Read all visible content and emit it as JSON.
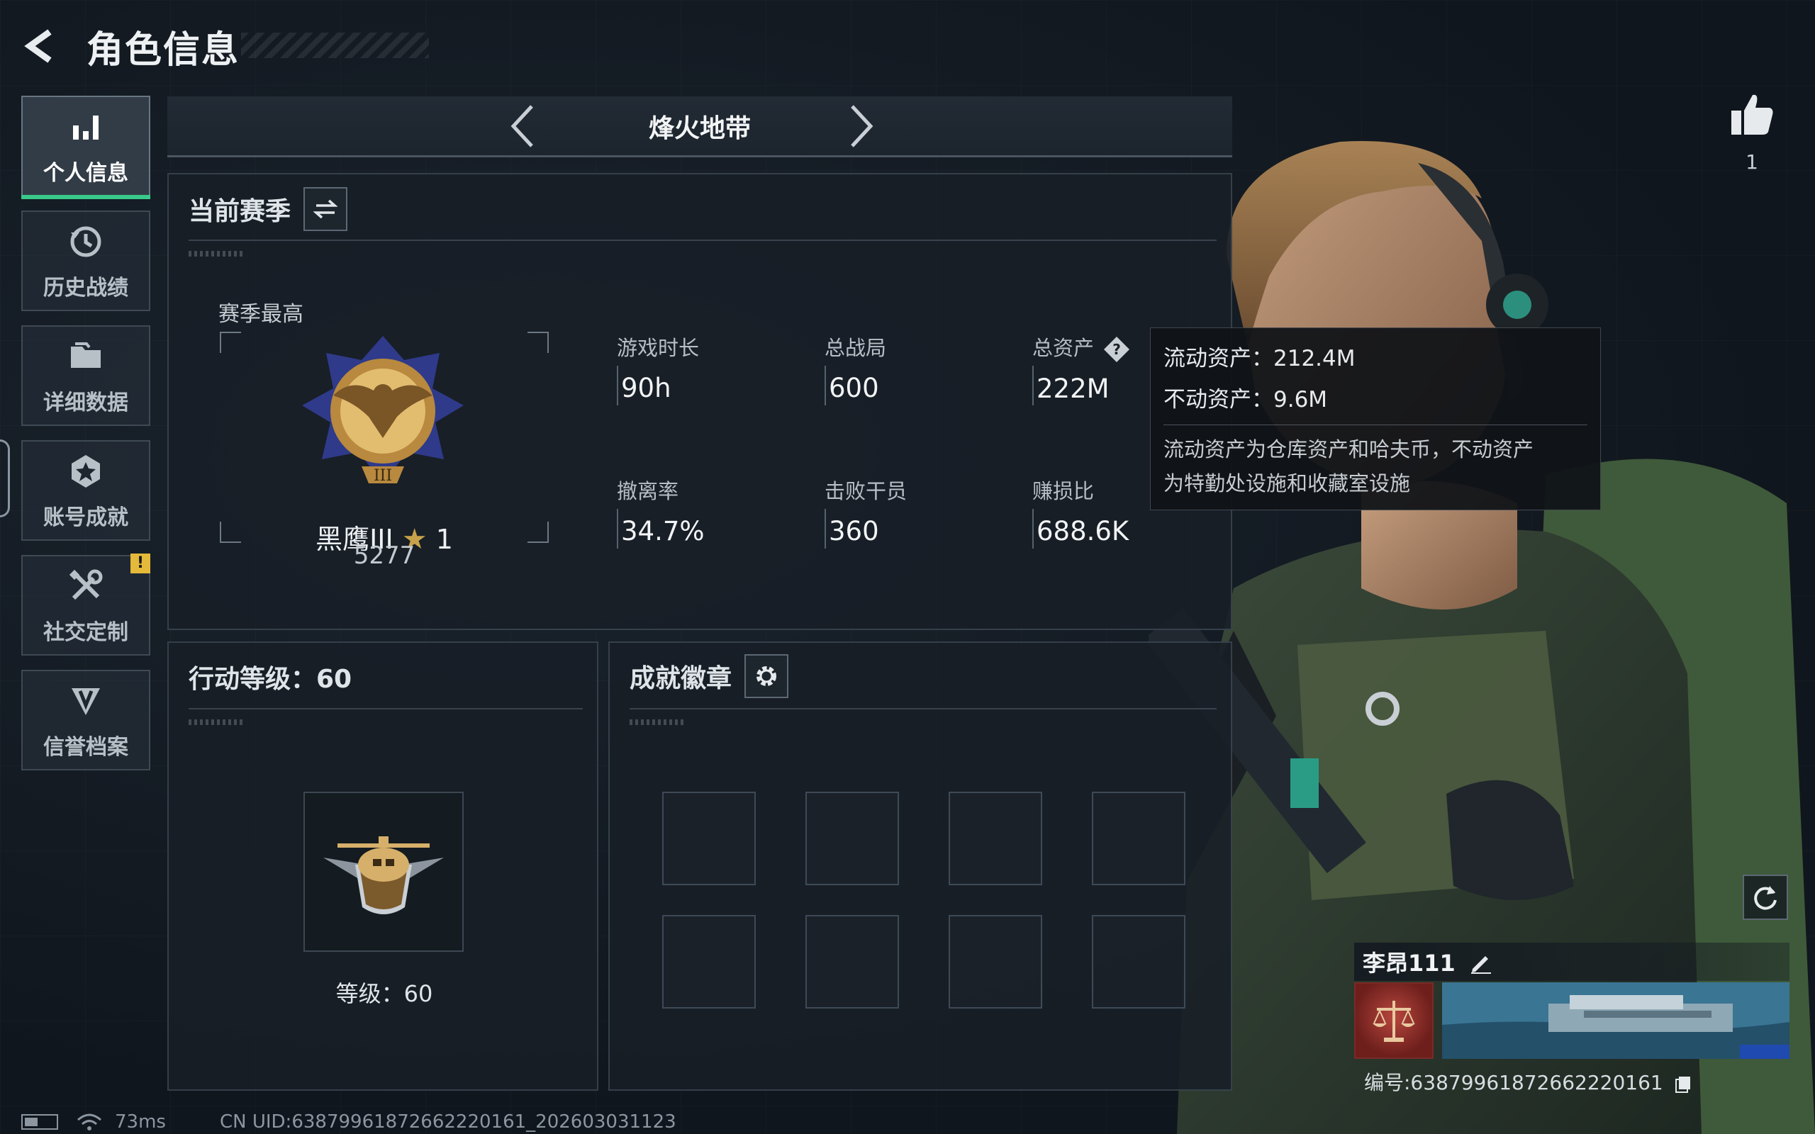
{
  "header": {
    "title": "角色信息"
  },
  "sidebar": {
    "items": [
      {
        "label": "个人信息",
        "icon": "bar-chart-icon",
        "active": true
      },
      {
        "label": "历史战绩",
        "icon": "history-clock-icon"
      },
      {
        "label": "详细数据",
        "icon": "folder-icon"
      },
      {
        "label": "账号成就",
        "icon": "achievement-star-icon"
      },
      {
        "label": "社交定制",
        "icon": "tools-icon",
        "badge": "!"
      },
      {
        "label": "信誉档案",
        "icon": "reputation-shield-icon"
      }
    ]
  },
  "mode": {
    "title": "烽火地带"
  },
  "season": {
    "title": "当前赛季",
    "best_label": "赛季最高",
    "rank_name": "黑鹰III",
    "rank_stars": "1",
    "rank_score": "5277",
    "stats": [
      {
        "label": "游戏时长",
        "value": "90h"
      },
      {
        "label": "总战局",
        "value": "600"
      },
      {
        "label": "总资产",
        "value": "222M"
      },
      {
        "label": "撤离率",
        "value": "34.7%"
      },
      {
        "label": "击败干员",
        "value": "360"
      },
      {
        "label": "赚损比",
        "value": "688.6K"
      }
    ]
  },
  "tooltip": {
    "liquid": "流动资产：212.4M",
    "fixed": "不动资产：9.6M",
    "note_line1": "流动资产为仓库资产和哈夫币，不动资产",
    "note_line2": "为特勤处设施和收藏室设施"
  },
  "level": {
    "title": "行动等级：60",
    "text": "等级：60"
  },
  "badges": {
    "title": "成就徽章"
  },
  "likes": {
    "count": "1"
  },
  "player": {
    "name": "李昂111",
    "id": "编号:6387996187266222016​1"
  },
  "status": {
    "ping": "73ms",
    "uid": "CN UID:6387996187266222016​1_202603031123"
  },
  "colors": {
    "accent": "#39c98a",
    "warning": "#e5b93a",
    "gold": "#c8a24a"
  }
}
